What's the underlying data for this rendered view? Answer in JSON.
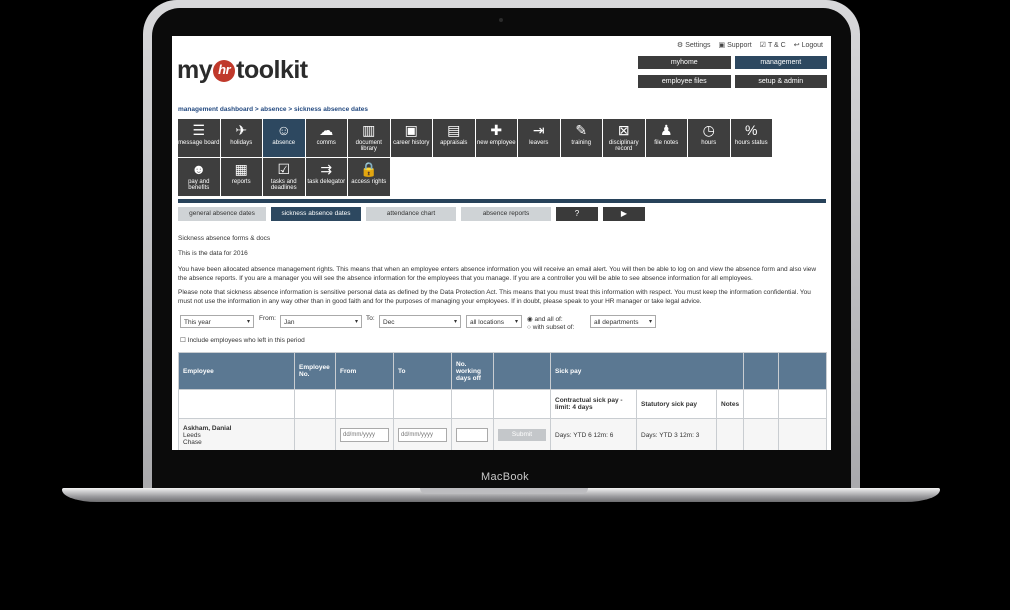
{
  "device": {
    "brand": "MacBook"
  },
  "header": {
    "links": [
      {
        "icon": "gear-icon",
        "label": "Settings"
      },
      {
        "icon": "briefcase-icon",
        "label": "Support"
      },
      {
        "icon": "checkbox-icon",
        "label": "T & C"
      },
      {
        "icon": "logout-icon",
        "label": "Logout"
      }
    ],
    "logo": {
      "left": "my",
      "mark": "hr",
      "right": "toolkit"
    },
    "nav": [
      {
        "label": "myhome",
        "active": false
      },
      {
        "label": "management",
        "active": true
      },
      {
        "label": "employee files",
        "active": false
      },
      {
        "label": "setup & admin",
        "active": false
      }
    ]
  },
  "breadcrumb": "management dashboard > absence > sickness absence dates",
  "modules": [
    {
      "label": "message board",
      "icon": "☰",
      "active": false
    },
    {
      "label": "holidays",
      "icon": "✈",
      "active": false
    },
    {
      "label": "absence",
      "icon": "☺",
      "active": true
    },
    {
      "label": "comms",
      "icon": "☁",
      "active": false
    },
    {
      "label": "document library",
      "icon": "▥",
      "active": false
    },
    {
      "label": "career history",
      "icon": "▣",
      "active": false
    },
    {
      "label": "appraisals",
      "icon": "▤",
      "active": false
    },
    {
      "label": "new employee",
      "icon": "✚",
      "active": false
    },
    {
      "label": "leavers",
      "icon": "⇥",
      "active": false
    },
    {
      "label": "training",
      "icon": "✎",
      "active": false
    },
    {
      "label": "disciplinary record",
      "icon": "⊠",
      "active": false
    },
    {
      "label": "file notes",
      "icon": "♟",
      "active": false
    },
    {
      "label": "hours",
      "icon": "◷",
      "active": false
    },
    {
      "label": "hours status",
      "icon": "%",
      "active": false
    },
    {
      "label": "pay and benefits",
      "icon": "☻",
      "active": false
    },
    {
      "label": "reports",
      "icon": "▦",
      "active": false
    },
    {
      "label": "tasks and deadlines",
      "icon": "☑",
      "active": false
    },
    {
      "label": "task delegator",
      "icon": "⇉",
      "active": false
    },
    {
      "label": "access rights",
      "icon": "🔒",
      "active": false
    }
  ],
  "tabs": [
    {
      "label": "general absence dates",
      "active": false
    },
    {
      "label": "sickness absence dates",
      "active": true
    },
    {
      "label": "attendance chart",
      "active": false
    },
    {
      "label": "absence reports",
      "active": false
    },
    {
      "label": "?",
      "icon": "help-icon"
    },
    {
      "label": "▶",
      "icon": "play-icon"
    }
  ],
  "content": {
    "forms_link": "Sickness absence forms & docs",
    "data_year": "This is the data for 2016",
    "para1": "You have been allocated absence management rights. This means that when an employee enters absence information you will receive an email alert. You will then be able to log on and view the absence form and also view the absence reports. If you are a manager you will see the absence information for the employees that you manage. If you are a controller you will be able to see absence information for all employees.",
    "para2": "Please note that sickness absence information is sensitive personal data as defined by the Data Protection Act. This means that you must treat this information with respect. You must keep the information confidential. You must not use the information in any way other than in good faith and for the purposes of managing your employees. If in doubt, please speak to your HR manager or take legal advice."
  },
  "filters": {
    "period": "This year",
    "from_label": "From:",
    "from": "Jan",
    "to_label": "To:",
    "to": "Dec",
    "locations": "all locations",
    "radio_all": "and all of:",
    "radio_subset": "with subset of:",
    "departments": "all departments",
    "include_leavers": "Include employees who left in this period"
  },
  "table": {
    "headers": [
      "Employee",
      "Employee No.",
      "From",
      "To",
      "No. working days off",
      "",
      "Sick pay"
    ],
    "sub": {
      "contractual": "Contractual sick pay - limit: 4 days",
      "statutory": "Statutory sick pay",
      "notes": "Notes"
    },
    "row": {
      "name": "Askham, Danial",
      "location": "Leeds",
      "dept": "Chase",
      "from_placeholder": "dd/mm/yyyy",
      "to_placeholder": "dd/mm/yyyy",
      "submit": "Submit",
      "contractual": "Days: YTD 6   12m: 6",
      "statutory": "Days: YTD 3   12m: 3"
    }
  }
}
